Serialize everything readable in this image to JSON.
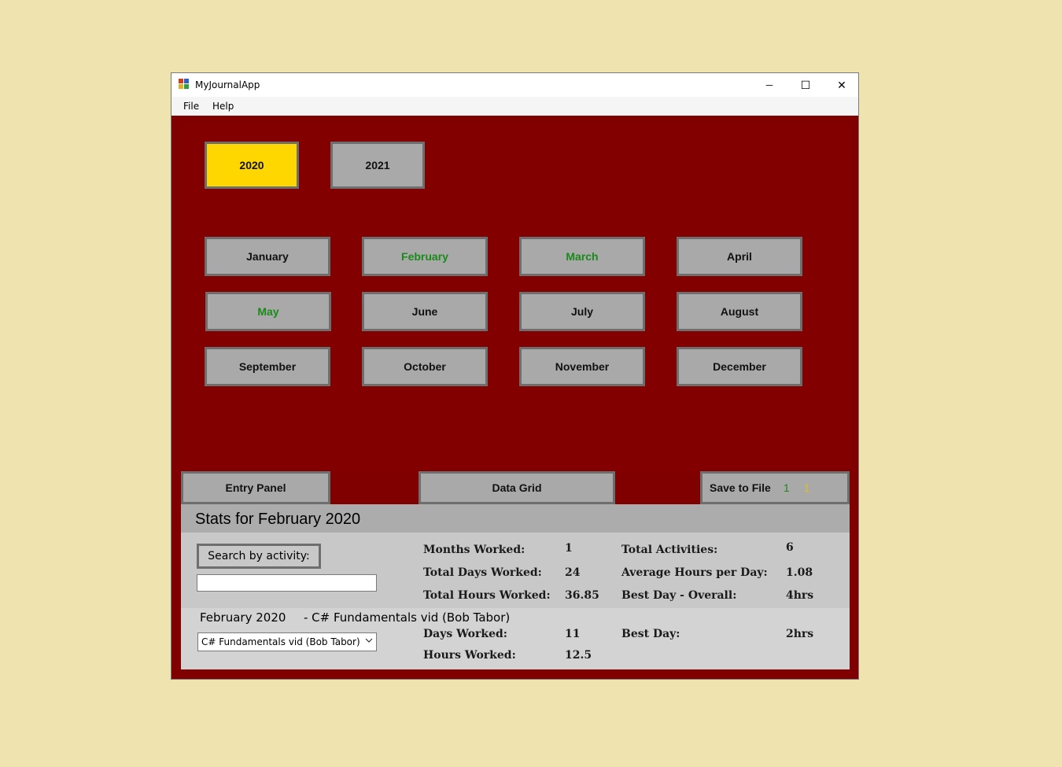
{
  "window": {
    "title": "MyJournalApp",
    "controls": {
      "minimize": "─",
      "maximize": "☐",
      "close": "✕"
    }
  },
  "menu": {
    "file": "File",
    "help": "Help"
  },
  "years": [
    {
      "label": "2020",
      "selected": true
    },
    {
      "label": "2021",
      "selected": false
    }
  ],
  "months": [
    {
      "label": "January",
      "has_data": false
    },
    {
      "label": "February",
      "has_data": true
    },
    {
      "label": "March",
      "has_data": true
    },
    {
      "label": "April",
      "has_data": false
    },
    {
      "label": "May",
      "has_data": true
    },
    {
      "label": "June",
      "has_data": false
    },
    {
      "label": "July",
      "has_data": false
    },
    {
      "label": "August",
      "has_data": false
    },
    {
      "label": "September",
      "has_data": false
    },
    {
      "label": "October",
      "has_data": false
    },
    {
      "label": "November",
      "has_data": false
    },
    {
      "label": "December",
      "has_data": false
    }
  ],
  "bottom_buttons": {
    "entry_panel": "Entry Panel",
    "data_grid": "Data Grid",
    "save_to_file": "Save to File",
    "save_indicator_1": "1",
    "save_indicator_2": "1"
  },
  "stats": {
    "title": "Stats for February 2020",
    "search_button": "Search by activity:",
    "search_value": "",
    "labels": {
      "months_worked": "Months Worked:",
      "total_days_worked": "Total Days Worked:",
      "total_hours_worked": "Total Hours Worked:",
      "total_activities": "Total Activities:",
      "average_hours_per_day": "Average Hours per Day:",
      "best_day_overall": "Best Day - Overall:"
    },
    "values": {
      "months_worked": "1",
      "total_days_worked": "24",
      "total_hours_worked": "36.85",
      "total_activities": "6",
      "average_hours_per_day": "1.08",
      "best_day_overall": "4hrs"
    },
    "activity": {
      "period": "February 2020",
      "name": "- C# Fundamentals vid (Bob Tabor)",
      "dropdown_selected": "C# Fundamentals vid (Bob Tabor)",
      "labels": {
        "days_worked": "Days Worked:",
        "hours_worked": "Hours Worked:",
        "best_day": "Best Day:"
      },
      "values": {
        "days_worked": "11",
        "hours_worked": "12.5",
        "best_day": "2hrs"
      }
    }
  },
  "colors": {
    "background": "#efe3b0",
    "client": "#800000",
    "button": "#a9a9a9",
    "selected_year": "#ffd700",
    "month_with_data": "#1a8a1a",
    "indicator_green": "#1a8a1a",
    "indicator_yellow": "#e0c020"
  }
}
